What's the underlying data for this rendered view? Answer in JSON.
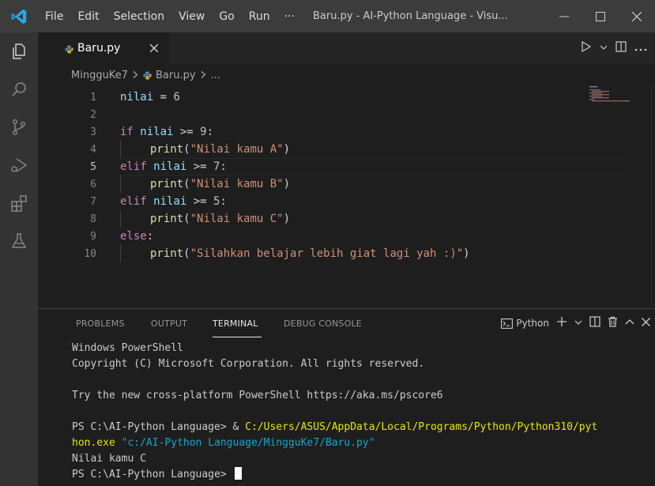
{
  "window": {
    "title": "Baru.py - AI-Python Language - Visu...",
    "menu": [
      "File",
      "Edit",
      "Selection",
      "View",
      "Go",
      "Run",
      "···"
    ]
  },
  "tab": {
    "label": "Baru.py"
  },
  "breadcrumb": {
    "folder": "MingguKe7",
    "file": "Baru.py",
    "more": "..."
  },
  "editor": {
    "line_numbers": [
      "1",
      "2",
      "3",
      "4",
      "5",
      "6",
      "7",
      "8",
      "9",
      "10"
    ],
    "active_line": "5",
    "code": {
      "l1": {
        "var": "nilai",
        "op": " = ",
        "num": "6"
      },
      "l3": {
        "kw": "if",
        "var": "nilai",
        "op": " >= ",
        "num": "9",
        "colon": ":"
      },
      "l4": {
        "fn": "print",
        "open": "(",
        "str": "\"Nilai kamu A\"",
        "close": ")"
      },
      "l5": {
        "kw": "elif",
        "var": "nilai",
        "op": " >= ",
        "num": "7",
        "colon": ":"
      },
      "l6": {
        "fn": "print",
        "open": "(",
        "str": "\"Nilai kamu B\"",
        "close": ")"
      },
      "l7": {
        "kw": "elif",
        "var": "nilai",
        "op": " >= ",
        "num": "5",
        "colon": ":"
      },
      "l8": {
        "fn": "print",
        "open": "(",
        "str": "\"Nilai kamu C\"",
        "close": ")"
      },
      "l9": {
        "kw": "else",
        "colon": ":"
      },
      "l10": {
        "fn": "print",
        "open": "(",
        "str": "\"Silahkan belajar lebih giat lagi yah :)\"",
        "close": ")"
      }
    }
  },
  "panel": {
    "tabs": [
      "PROBLEMS",
      "OUTPUT",
      "TERMINAL",
      "DEBUG CONSOLE"
    ],
    "active_tab": "TERMINAL",
    "terminal_name": "Python",
    "terminal": {
      "line1": "Windows PowerShell",
      "line2": "Copyright (C) Microsoft Corporation. All rights reserved.",
      "line4": "Try the new cross-platform PowerShell https://aka.ms/pscore6",
      "prompt": "PS C:\\AI-Python Language> ",
      "amp": "& ",
      "exe_part1": "C:/Users/ASUS/AppData/Local/Programs/Python/Python310/pyt",
      "exe_part2": "hon.exe",
      "arg": " \"c:/AI-Python Language/MingguKe7/Baru.py\"",
      "output": "Nilai kamu C",
      "prompt_final": "PS C:\\AI-Python Language> "
    }
  },
  "colors": {
    "titlebar": "#3c3c3c",
    "activitybar": "#333333",
    "editor_bg": "#1e1e1e",
    "keyword": "#c586c0",
    "variable": "#9cdcfe",
    "number": "#b5cea8",
    "function": "#dcdcaa",
    "string": "#ce9178",
    "terminal_yellow": "#e5e510",
    "terminal_cyan": "#11a8cd"
  }
}
